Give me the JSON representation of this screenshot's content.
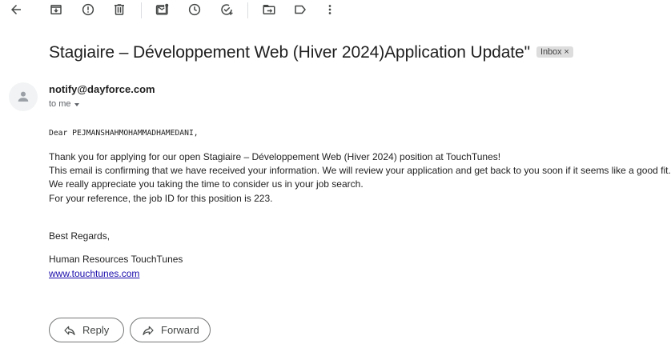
{
  "toolbar": {
    "icons": [
      "back-arrow-icon",
      "archive-icon",
      "report-spam-icon",
      "delete-icon",
      "mark-unread-icon",
      "snooze-icon",
      "add-to-tasks-icon",
      "move-to-icon",
      "label-icon",
      "more-options-icon"
    ]
  },
  "email": {
    "subject": "Stagiaire – Développement Web (Hiver 2024)Application Update\"",
    "label": "Inbox",
    "label_remove": "×",
    "sender": "notify@dayforce.com",
    "recipient": "to me",
    "greeting": "Dear PEJMANSHAHMOHAMMADHAMEDANI,",
    "body_lines": [
      "Thank you for applying for our open Stagiaire – Développement Web (Hiver 2024) position at TouchTunes!",
      "This email is confirming that we have received your information. We will review your application and get back to you soon if it seems like a good fit.",
      "We really appreciate you taking the time to consider us in your job search.",
      "For your reference, the job ID for this position is 223."
    ],
    "closing": "Best Regards,",
    "signature": "Human Resources TouchTunes",
    "link": "www.touchtunes.com"
  },
  "actions": {
    "reply": "Reply",
    "forward": "Forward"
  },
  "colors": {
    "icon": "#444746",
    "link": "#1a0dab",
    "chip_bg": "#dddddd"
  }
}
